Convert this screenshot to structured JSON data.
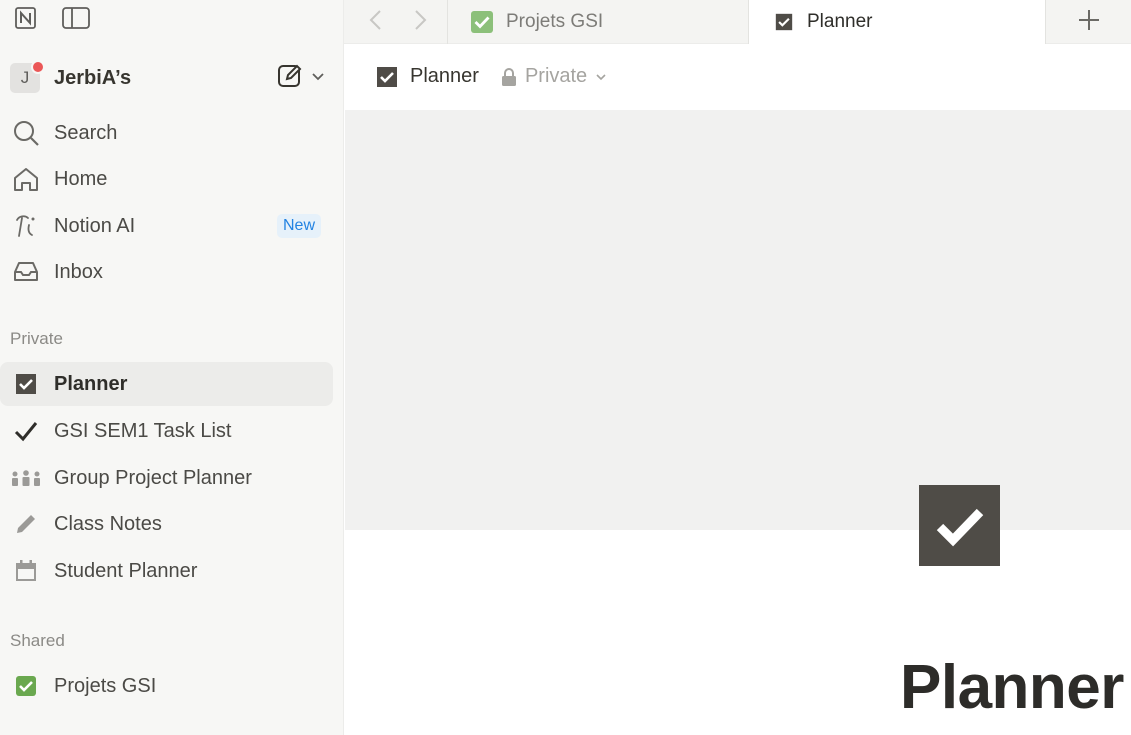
{
  "sidebar": {
    "workspace": {
      "initial": "J",
      "name": "JerbiA’s"
    },
    "nav": [
      {
        "label": "Search",
        "icon": "search-icon"
      },
      {
        "label": "Home",
        "icon": "home-icon"
      },
      {
        "label": "Notion AI",
        "icon": "notion-ai-icon",
        "badge": "New"
      },
      {
        "label": "Inbox",
        "icon": "inbox-icon"
      }
    ],
    "private_label": "Private",
    "private_pages": [
      {
        "label": "Planner",
        "icon": "checkbox-icon",
        "active": true
      },
      {
        "label": "GSI SEM1 Task List",
        "icon": "checkmark-icon"
      },
      {
        "label": "Group Project Planner",
        "icon": "group-icon"
      },
      {
        "label": "Class Notes",
        "icon": "pencil-icon"
      },
      {
        "label": "Student Planner",
        "icon": "calendar-icon"
      }
    ],
    "shared_label": "Shared",
    "shared_pages": [
      {
        "label": "Projets GSI",
        "icon": "green-check-icon"
      }
    ]
  },
  "tabs": [
    {
      "label": "Projets GSI",
      "icon": "green-check-icon",
      "active": false
    },
    {
      "label": "Planner",
      "icon": "checkbox-icon",
      "active": true
    }
  ],
  "header": {
    "title": "Planner",
    "privacy": "Private"
  },
  "page": {
    "title": "Planner"
  },
  "colors": {
    "sidebar_bg": "#f7f7f5",
    "accent_blue": "#2383e2",
    "notion_green": "#6aa84f",
    "icon_dark": "#4f4c47",
    "notification": "#eb5757"
  }
}
